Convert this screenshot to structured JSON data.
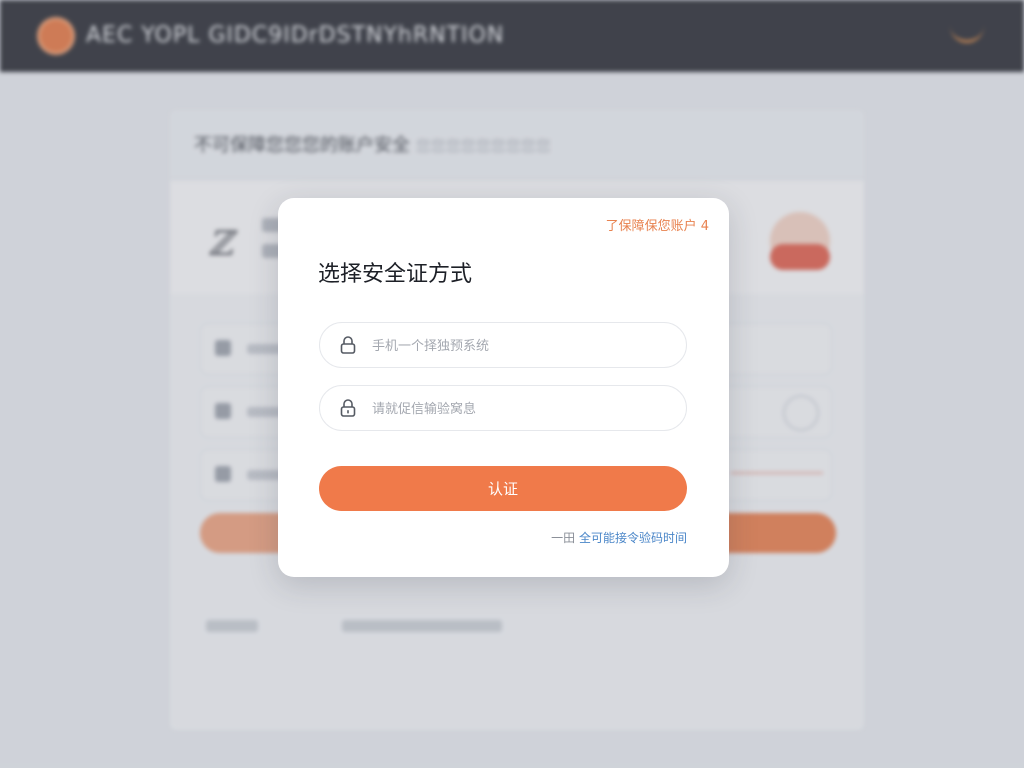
{
  "background": {
    "brand_text": "AEC YOPL GIDC9IDrDSTNYhRNTION",
    "card_title": "不可保障您您您的账户安全",
    "card_title_sub": "您您您您您您您您您"
  },
  "modal": {
    "top_link": "了保障保您账户 4",
    "title": "选择安全证方式",
    "phone_field": {
      "icon": "user-lock-icon",
      "placeholder": "手机一个择独预系统",
      "value": ""
    },
    "code_field": {
      "icon": "padlock-icon",
      "placeholder": "请就促信输验窝息",
      "value": ""
    },
    "submit_label": "认证",
    "bottom_prefix": "一田",
    "bottom_link": "全可能接令验码时间"
  },
  "colors": {
    "accent": "#f07a4a",
    "link": "#4a86c8",
    "topbar": "#23252d"
  }
}
